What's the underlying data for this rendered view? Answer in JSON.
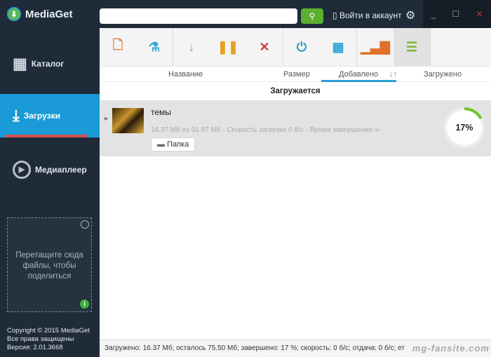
{
  "app": {
    "title": "MediaGet"
  },
  "topbar": {
    "search_placeholder": "",
    "login": "Войти в аккаунт"
  },
  "sidebar": {
    "items": [
      {
        "label": "Каталог"
      },
      {
        "label": "Загрузки"
      },
      {
        "label": "Медиаплеер"
      }
    ],
    "dropzone": "Перетащите сюда файлы, чтобы поделиться",
    "copyright": [
      "Copyright © 2015 MediaGet",
      "Все права защищены",
      "Версия: 2.01.3668"
    ]
  },
  "columns": {
    "name": "Название",
    "size": "Размер",
    "added": "Добавлено",
    "sort": "↓↑",
    "downloaded": "Загружено"
  },
  "section": "Загружается",
  "download": {
    "name": "темы",
    "meta": "16.37 Мб из 91.87 Мб - Скорость загрузки 0 б/с - Время завершения ∞",
    "folder": "Папка",
    "progress": 17,
    "progress_label": "17%"
  },
  "status": "Загружено: 16.37 Мб; осталось 75.50 Мб; завершено: 17 %; скорость: 0 б/с; отдача: 0 б/с; ет",
  "watermark": "mg-fansite.com",
  "colors": {
    "accent": "#1a9ad6",
    "progress": "#6cc52c",
    "sidebar": "#1f2b39"
  }
}
